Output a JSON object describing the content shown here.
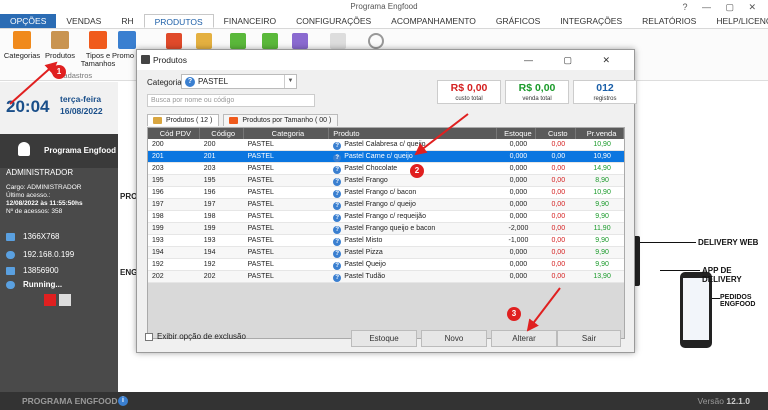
{
  "window": {
    "title": "Programa Engfood",
    "controls": "? — ▢ ✕"
  },
  "menu": [
    "OPÇÕES",
    "VENDAS",
    "RH",
    "PRODUTOS",
    "FINANCEIRO",
    "CONFIGURAÇÕES",
    "ACOMPANHAMENTO",
    "GRÁFICOS",
    "INTEGRAÇÕES",
    "RELATÓRIOS",
    "HELP/LICENÇA"
  ],
  "ribbon": {
    "categorias": "Categorias",
    "produtos": "Produtos",
    "tipos": "Tipos e Tamanhos",
    "promo": "Promo",
    "group": "Cadastros"
  },
  "sidebar": {
    "time": "20:04",
    "weekday": "terça-feira",
    "date": "16/08/2022",
    "brand": "Programa Engfood",
    "user": "ADMINISTRADOR",
    "cargo": "Cargo: ADMINISTRADOR",
    "last_access_label": "Último acesso.:",
    "last_access": "12/08/2022 às 11:55:50hs",
    "access_count": "Nº de acessos: 358",
    "resolution": "1366X768",
    "ip": "192.168.0.199",
    "serial": "13856900",
    "status": "Running..."
  },
  "background": {
    "left1": "PRO",
    "left2": "ENG",
    "delivery_web": "DELIVERY WEB",
    "app_delivery": "APP DE DELIVERY",
    "pedidos": "PEDIDOS ENGFOOD"
  },
  "footer": {
    "left": "PROGRAMA ENGFOOD",
    "version_label": "Versão",
    "version": "12.1.0",
    "info": "i"
  },
  "dialog": {
    "title": "Produtos",
    "window_controls": "— ▢ ✕",
    "categoria_label": "Categoria",
    "categoria_value": "PASTEL",
    "search_placeholder": "Busca por nome ou código",
    "stats": [
      {
        "value": "R$ 0,00",
        "caption": "custo total",
        "color": "#d42020"
      },
      {
        "value": "R$ 0,00",
        "caption": "venda total",
        "color": "#1a9a2a"
      },
      {
        "value": "012",
        "caption": "registros",
        "color": "#1a5fa8"
      }
    ],
    "tabs": [
      "Produtos ( 12 )",
      "Produtos por Tamanho ( 00 )"
    ],
    "columns": [
      "Cód PDV",
      "Código",
      "Categoria",
      "Produto",
      "Estoque",
      "Custo",
      "Pr.venda"
    ],
    "rows": [
      [
        "200",
        "200",
        "PASTEL",
        "Pastel Calabresa c/ queijo",
        "0,000",
        "0,00",
        "10,90"
      ],
      [
        "201",
        "201",
        "PASTEL",
        "Pastel Carne c/ queijo",
        "0,000",
        "0,00",
        "10,90"
      ],
      [
        "203",
        "203",
        "PASTEL",
        "Pastel Chocolate",
        "0,000",
        "0,00",
        "14,90"
      ],
      [
        "195",
        "195",
        "PASTEL",
        "Pastel Frango",
        "0,000",
        "0,00",
        "8,90"
      ],
      [
        "196",
        "196",
        "PASTEL",
        "Pastel Frango c/ bacon",
        "0,000",
        "0,00",
        "10,90"
      ],
      [
        "197",
        "197",
        "PASTEL",
        "Pastel Frango c/ queijo",
        "0,000",
        "0,00",
        "9,90"
      ],
      [
        "198",
        "198",
        "PASTEL",
        "Pastel Frango c/ requeijão",
        "0,000",
        "0,00",
        "9,90"
      ],
      [
        "199",
        "199",
        "PASTEL",
        "Pastel Frango queijo e bacon",
        "-2,000",
        "0,00",
        "11,90"
      ],
      [
        "193",
        "193",
        "PASTEL",
        "Pastel Misto",
        "-1,000",
        "0,00",
        "9,90"
      ],
      [
        "194",
        "194",
        "PASTEL",
        "Pastel Pizza",
        "0,000",
        "0,00",
        "9,90"
      ],
      [
        "192",
        "192",
        "PASTEL",
        "Pastel Queijo",
        "0,000",
        "0,00",
        "9,90"
      ],
      [
        "202",
        "202",
        "PASTEL",
        "Pastel Tudão",
        "0,000",
        "0,00",
        "13,90"
      ]
    ],
    "selected_row": 1,
    "checkbox_label": "Exibir opção de exclusão",
    "buttons": {
      "estoque": "Estoque",
      "novo": "Novo",
      "alterar": "Alterar",
      "sair": "Sair"
    }
  },
  "markers": [
    "1",
    "2",
    "3"
  ]
}
